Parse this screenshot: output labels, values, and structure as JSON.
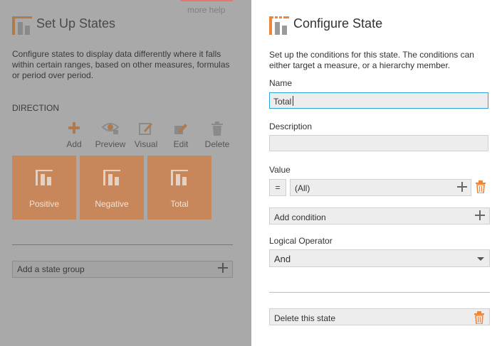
{
  "left_panel": {
    "more_help": "more help",
    "title": "Set Up States",
    "description": "Configure states to display data differently where it falls within certain ranges, based on other measures, formulas or period over period.",
    "section_label": "DIRECTION",
    "toolbar": [
      {
        "label": "Add",
        "icon": "plus-icon"
      },
      {
        "label": "Preview",
        "icon": "eye-icon"
      },
      {
        "label": "Visual",
        "icon": "visual-edit-icon"
      },
      {
        "label": "Edit",
        "icon": "edit-icon"
      },
      {
        "label": "Delete",
        "icon": "trash-icon"
      }
    ],
    "states": [
      {
        "label": "Positive"
      },
      {
        "label": "Negative"
      },
      {
        "label": "Total"
      }
    ],
    "add_group_label": "Add a state group"
  },
  "right_panel": {
    "title": "Configure State",
    "description": "Set up the conditions for this state. The conditions can either target a measure, or a hierarchy member.",
    "name_label": "Name",
    "name_value": "Total",
    "description_label": "Description",
    "description_value": "",
    "value_label": "Value",
    "operator_symbol": "=",
    "value_text": "(All)",
    "add_condition_label": "Add condition",
    "logical_operator_label": "Logical Operator",
    "logical_operator_value": "And",
    "delete_state_label": "Delete this state"
  },
  "colors": {
    "accent_orange": "#f0853a",
    "dim_overlay": "#a9a9a9",
    "tile": "#c7875a",
    "focus_border": "#2aa3d6"
  }
}
